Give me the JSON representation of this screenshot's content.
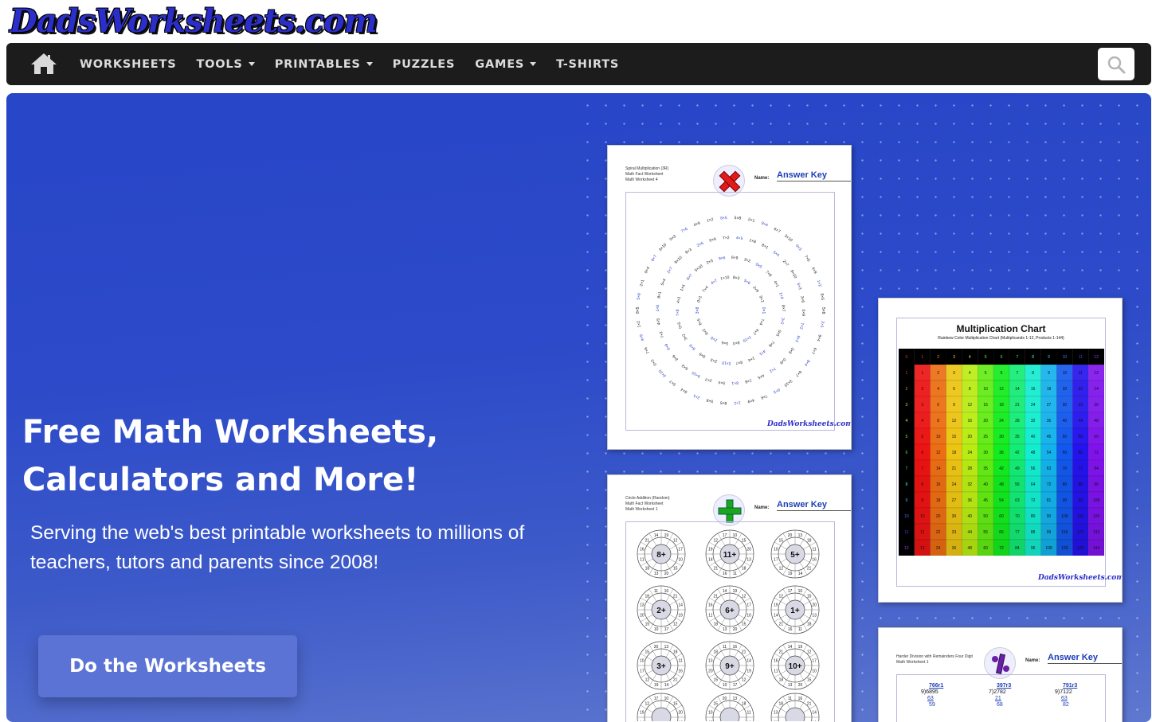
{
  "site": {
    "logo_text": "DadsWorksheets.com"
  },
  "nav": {
    "items": [
      {
        "label": "WORKSHEETS",
        "dropdown": false
      },
      {
        "label": "TOOLS",
        "dropdown": true
      },
      {
        "label": "PRINTABLES",
        "dropdown": true
      },
      {
        "label": "PUZZLES",
        "dropdown": false
      },
      {
        "label": "GAMES",
        "dropdown": true
      },
      {
        "label": "T-SHIRTS",
        "dropdown": false
      }
    ]
  },
  "hero": {
    "title_line1": "Free Math Worksheets,",
    "title_line2": "Calculators and More!",
    "subtitle_line1": "Serving the web's best printable worksheets to millions of",
    "subtitle_line2": "teachers, tutors and parents since 2008!",
    "cta_label": "Do the Worksheets"
  },
  "sheets": {
    "spiral": {
      "header_lines": [
        "Spiral Multiplication (3R)",
        "Math Fact Worksheet",
        "Math Worksheet 4"
      ],
      "name_label": "Name:",
      "answer_key": "Answer Key",
      "footer_logo": "DadsWorksheets.com"
    },
    "chart": {
      "title": "Multiplication Chart",
      "subtitle": "Rainbow Color Multiplication Chart (Multiplicands 1-12, Products 1-144)",
      "footer_logo": "DadsWorksheets.com"
    },
    "circle": {
      "header_lines": [
        "Circle Addition (Random)",
        "Math Fact Worksheet",
        "Math Worksheet 1"
      ],
      "name_label": "Name:",
      "answer_key": "Answer Key",
      "center_labels": [
        "8+",
        "11+",
        "5+",
        "2+",
        "6+",
        "1+",
        "3+",
        "9+",
        "10+"
      ]
    },
    "division": {
      "header_lines": [
        "Harder Division with Remainders Four Digit",
        "Math Worksheet 1"
      ],
      "name_label": "Name:",
      "answer_key": "Answer Key",
      "problems": [
        {
          "quotient": "766r1",
          "divisor": "9",
          "dividend": "6895",
          "step1": "63",
          "step2": "59"
        },
        {
          "quotient": "397r3",
          "divisor": "7",
          "dividend": "2782",
          "step1": "21",
          "step2": "68"
        },
        {
          "quotient": "791r3",
          "divisor": "9",
          "dividend": "7122",
          "step1": "63",
          "step2": "82"
        }
      ]
    }
  },
  "colors": {
    "hero_blue": "#2c4ac9",
    "navbar_bg": "#1c1c1c",
    "cta_bg": "#5a73d4",
    "answer_key_blue": "#1d3fb8"
  }
}
